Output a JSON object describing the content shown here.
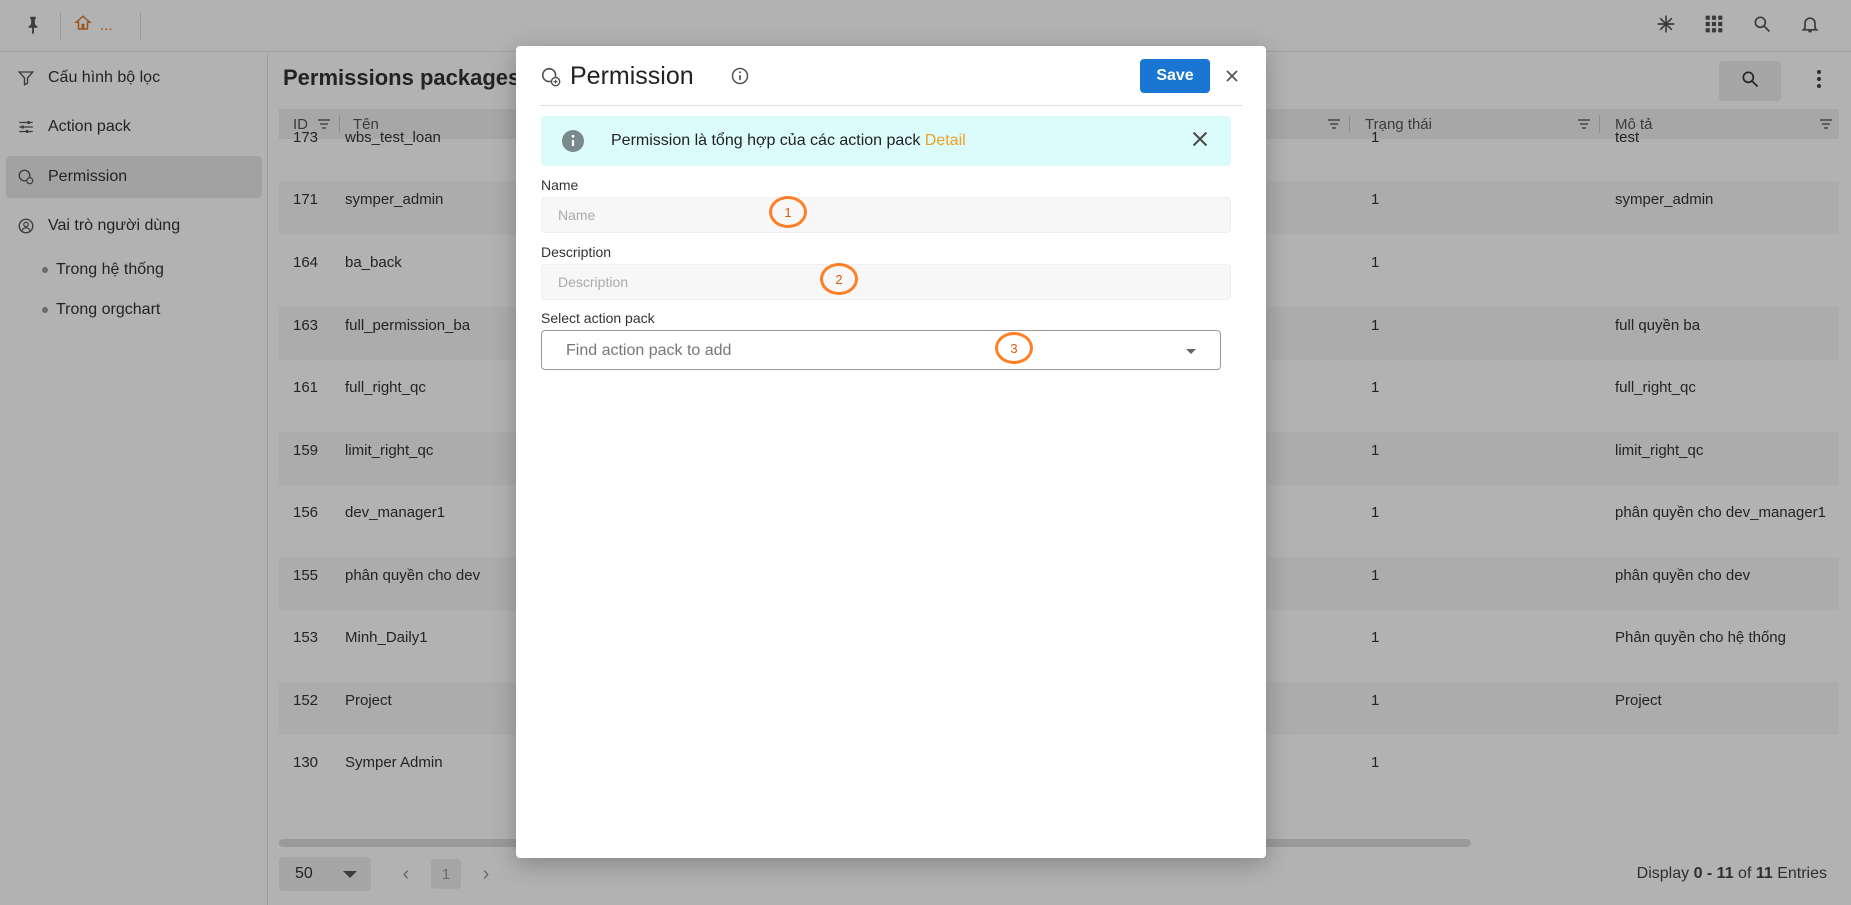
{
  "topbar": {
    "breadcrumb_text": "...",
    "icons": [
      "pin-icon",
      "home-icon",
      "asterisk-icon",
      "apps-grid-icon",
      "search-icon",
      "bell-icon"
    ]
  },
  "sidebar": {
    "items": [
      {
        "label": "Cấu hình bộ lọc",
        "icon": "filter-icon"
      },
      {
        "label": "Action pack",
        "icon": "sliders-icon"
      },
      {
        "label": "Permission",
        "icon": "permission-icon",
        "active": true
      },
      {
        "label": "Vai trò người dùng",
        "icon": "user-circle-icon"
      }
    ],
    "subitems": [
      {
        "label": "Trong hệ thống"
      },
      {
        "label": "Trong orgchart"
      }
    ]
  },
  "main": {
    "title": "Permissions packages",
    "columns": [
      "ID",
      "Tên",
      "Trạng thái",
      "Mô tả"
    ],
    "rows": [
      {
        "id": "173",
        "name": "wbs_test_loan",
        "status": "1",
        "desc": "test"
      },
      {
        "id": "171",
        "name": "symper_admin",
        "status": "1",
        "desc": "symper_admin"
      },
      {
        "id": "164",
        "name": "ba_back",
        "status": "1",
        "desc": ""
      },
      {
        "id": "163",
        "name": "full_permission_ba",
        "status": "1",
        "desc": "full quyền ba"
      },
      {
        "id": "161",
        "name": "full_right_qc",
        "status": "1",
        "desc": "full_right_qc"
      },
      {
        "id": "159",
        "name": "limit_right_qc",
        "status": "1",
        "desc": "limit_right_qc"
      },
      {
        "id": "156",
        "name": "dev_manager1",
        "status": "1",
        "desc": "phân quyền cho dev_manager1"
      },
      {
        "id": "155",
        "name": "phân quyền cho dev",
        "status": "1",
        "desc": "phân quyền cho dev"
      },
      {
        "id": "153",
        "name": "Minh_Daily1",
        "status": "1",
        "desc": "Phân quyền cho hệ thống"
      },
      {
        "id": "152",
        "name": "Project",
        "status": "1",
        "desc": "Project"
      },
      {
        "id": "130",
        "name": "Symper Admin",
        "status": "1",
        "desc": ""
      }
    ],
    "pager": {
      "page_size": "50",
      "current_page": "1",
      "display_prefix": "Display ",
      "display_range": "0 - 11",
      "display_of": " of ",
      "display_total": "11",
      "display_suffix": " Entries"
    }
  },
  "dialog": {
    "title": "Permission",
    "save_label": "Save",
    "alert_text": "Permission là tổng hợp của các action pack ",
    "alert_link": "Detail",
    "name_label": "Name",
    "name_placeholder": "Name",
    "description_label": "Description",
    "description_placeholder": "Description",
    "action_pack_label": "Select action pack",
    "action_pack_placeholder": "Find action pack to add",
    "markers": [
      "1",
      "2",
      "3"
    ],
    "colors": {
      "primary": "#1976d2",
      "link": "#f0a020",
      "alert_bg": "#dcfbfb",
      "marker": "#ff7f27"
    }
  }
}
